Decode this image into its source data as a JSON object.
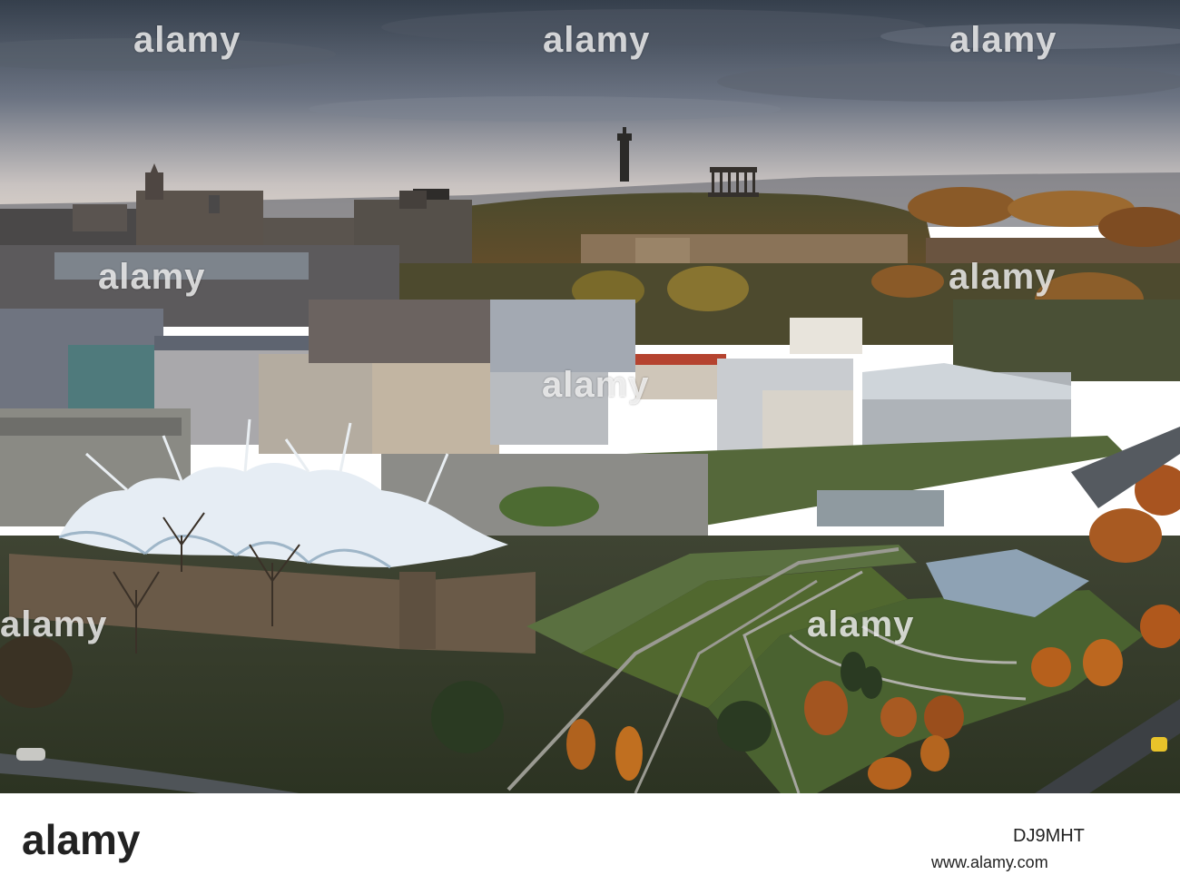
{
  "watermark": {
    "text": "alamy"
  },
  "footer": {
    "brand": "alamy",
    "image_id": "DJ9MHT",
    "site": "www.alamy.com"
  },
  "colors": {
    "sky_top": "#3c4652",
    "sky_glow": "#c9c2c0",
    "hill": "#5c4a2c",
    "lawn": "#4a5a2e",
    "canopy": "#f2f6fb"
  }
}
